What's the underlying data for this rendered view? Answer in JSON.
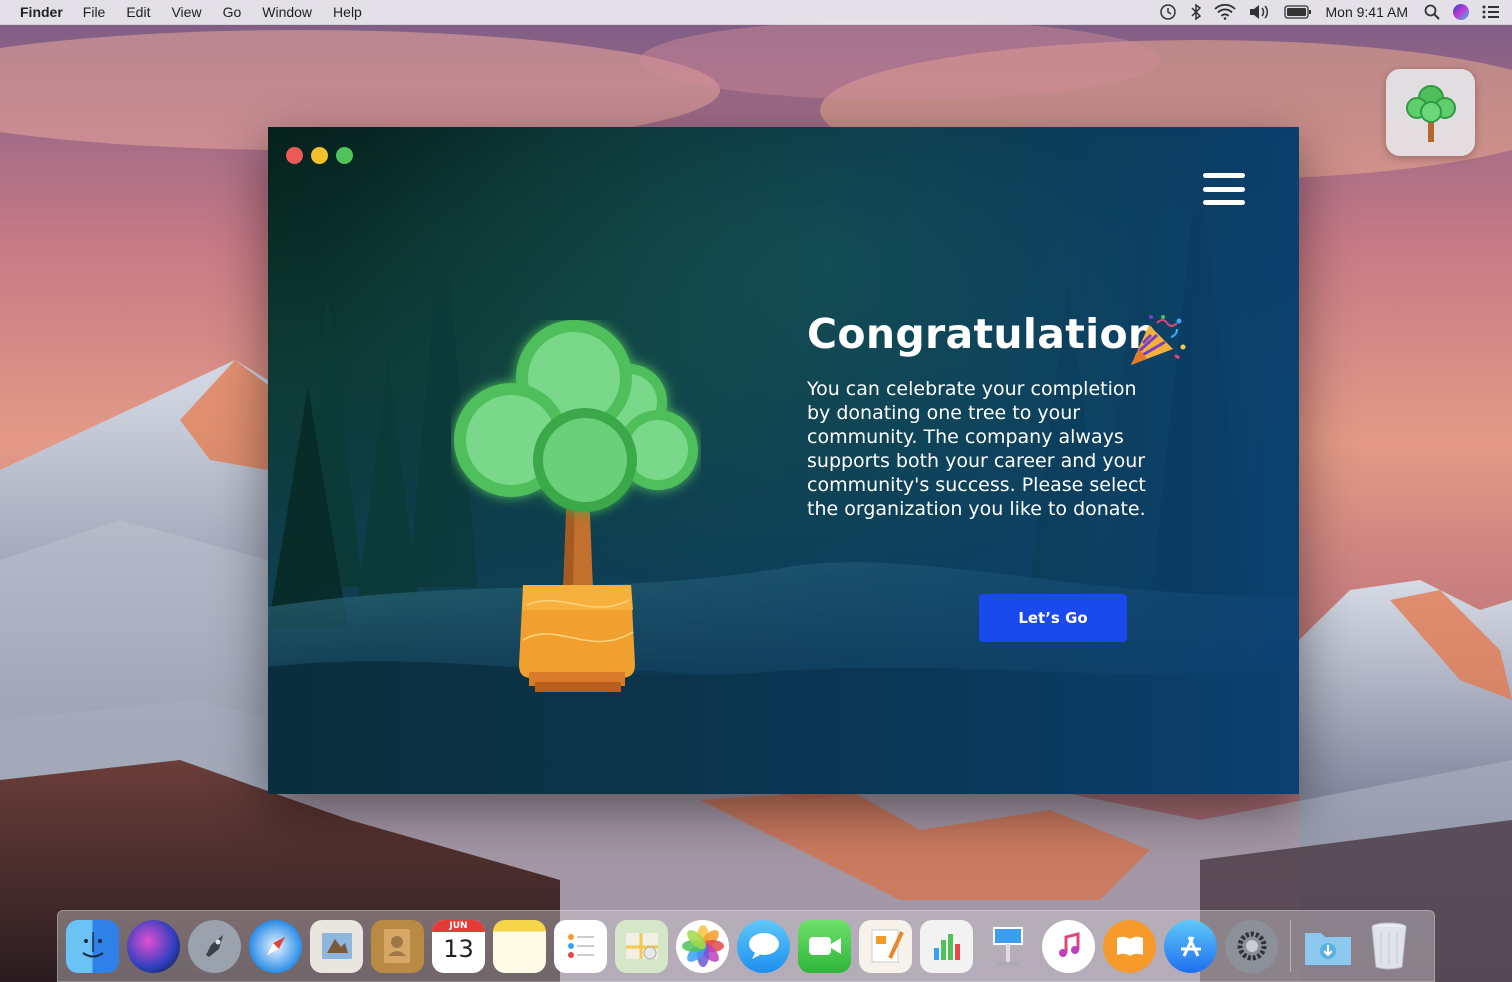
{
  "menubar": {
    "app_name": "Finder",
    "menus": [
      "File",
      "Edit",
      "View",
      "Go",
      "Window",
      "Help"
    ],
    "clock": "Mon 9:41 AM",
    "status_icons": [
      "time-machine-icon",
      "bluetooth-icon",
      "wifi-icon",
      "volume-icon",
      "battery-icon",
      "spotlight-icon",
      "siri-icon",
      "notification-center-icon"
    ]
  },
  "desktop": {
    "app_icon": "tree-app-icon"
  },
  "window": {
    "title": "Congratulation",
    "emoji_icon": "party-popper-icon",
    "message": "You can celebrate your completion by donating one tree to your community. The company always supports both your career and your community's success. Please select the organization you like to donate.",
    "cta_label": "Let’s Go",
    "menu_icon": "hamburger-menu-icon",
    "illustration": "potted-tree-illustration"
  },
  "dock": {
    "apps": [
      {
        "name": "finder",
        "icon": "finder-icon"
      },
      {
        "name": "siri",
        "icon": "siri-icon"
      },
      {
        "name": "launchpad",
        "icon": "launchpad-icon"
      },
      {
        "name": "safari",
        "icon": "safari-icon"
      },
      {
        "name": "mail",
        "icon": "mail-icon"
      },
      {
        "name": "contacts",
        "icon": "contacts-icon"
      },
      {
        "name": "calendar",
        "icon": "calendar-icon",
        "month": "JUN",
        "day": "13"
      },
      {
        "name": "notes",
        "icon": "notes-icon"
      },
      {
        "name": "reminders",
        "icon": "reminders-icon"
      },
      {
        "name": "maps",
        "icon": "maps-icon"
      },
      {
        "name": "photos",
        "icon": "photos-icon"
      },
      {
        "name": "messages",
        "icon": "messages-icon"
      },
      {
        "name": "facetime",
        "icon": "facetime-icon"
      },
      {
        "name": "pages",
        "icon": "pages-icon"
      },
      {
        "name": "numbers",
        "icon": "numbers-icon"
      },
      {
        "name": "keynote",
        "icon": "keynote-icon"
      },
      {
        "name": "itunes",
        "icon": "itunes-icon"
      },
      {
        "name": "ibooks",
        "icon": "ibooks-icon"
      },
      {
        "name": "app-store",
        "icon": "app-store-icon"
      },
      {
        "name": "system-preferences",
        "icon": "system-preferences-icon"
      },
      {
        "name": "downloads",
        "icon": "downloads-folder-icon"
      },
      {
        "name": "trash",
        "icon": "trash-icon"
      }
    ]
  },
  "colors": {
    "cta": "#1a49ee",
    "window_top": "#0b2a22",
    "window_bottom": "#0c3a5a",
    "tree_green": "#5fcf76",
    "pot_orange": "#f0a02e"
  }
}
